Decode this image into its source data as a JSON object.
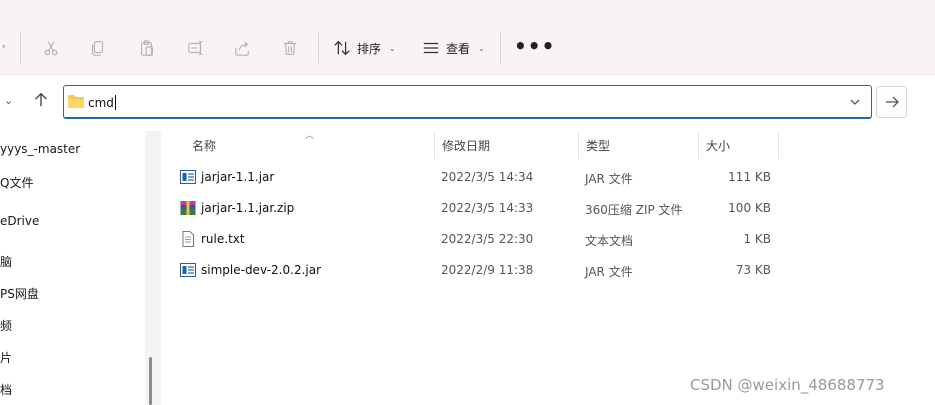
{
  "toolbar": {
    "cut_icon": "scissors-icon",
    "copy_icon": "copy-icon",
    "paste_icon": "paste-icon",
    "rename_icon": "rename-icon",
    "share_icon": "share-icon",
    "delete_icon": "trash-icon",
    "sort_label": "排序",
    "view_label": "查看",
    "more_label": "•••"
  },
  "address": {
    "folder_name": "cmd"
  },
  "sidebar": {
    "items": [
      {
        "label": "yyys_-master"
      },
      {
        "label": "Q文件"
      },
      {
        "label": "eDrive"
      },
      {
        "label": "脑"
      },
      {
        "label": "PS网盘"
      },
      {
        "label": "频"
      },
      {
        "label": "片"
      },
      {
        "label": "档"
      }
    ]
  },
  "columns": {
    "name": "名称",
    "date": "修改日期",
    "type": "类型",
    "size": "大小"
  },
  "files": [
    {
      "name": "jarjar-1.1.jar",
      "date": "2022/3/5 14:34",
      "type": "JAR 文件",
      "size": "111 KB",
      "icon": "jar-file-icon"
    },
    {
      "name": "jarjar-1.1.jar.zip",
      "date": "2022/3/5 14:33",
      "type": "360压缩 ZIP 文件",
      "size": "100 KB",
      "icon": "zip-archive-icon"
    },
    {
      "name": "rule.txt",
      "date": "2022/3/5 22:30",
      "type": "文本文档",
      "size": "1 KB",
      "icon": "text-file-icon"
    },
    {
      "name": "simple-dev-2.0.2.jar",
      "date": "2022/2/9 11:38",
      "type": "JAR 文件",
      "size": "73 KB",
      "icon": "jar-file-icon"
    }
  ],
  "watermark": "CSDN @weixin_48688773",
  "colors": {
    "toolbar_bg": "#f9f3f3",
    "accent": "#1a6fa8",
    "folder": "#f2c94c"
  }
}
